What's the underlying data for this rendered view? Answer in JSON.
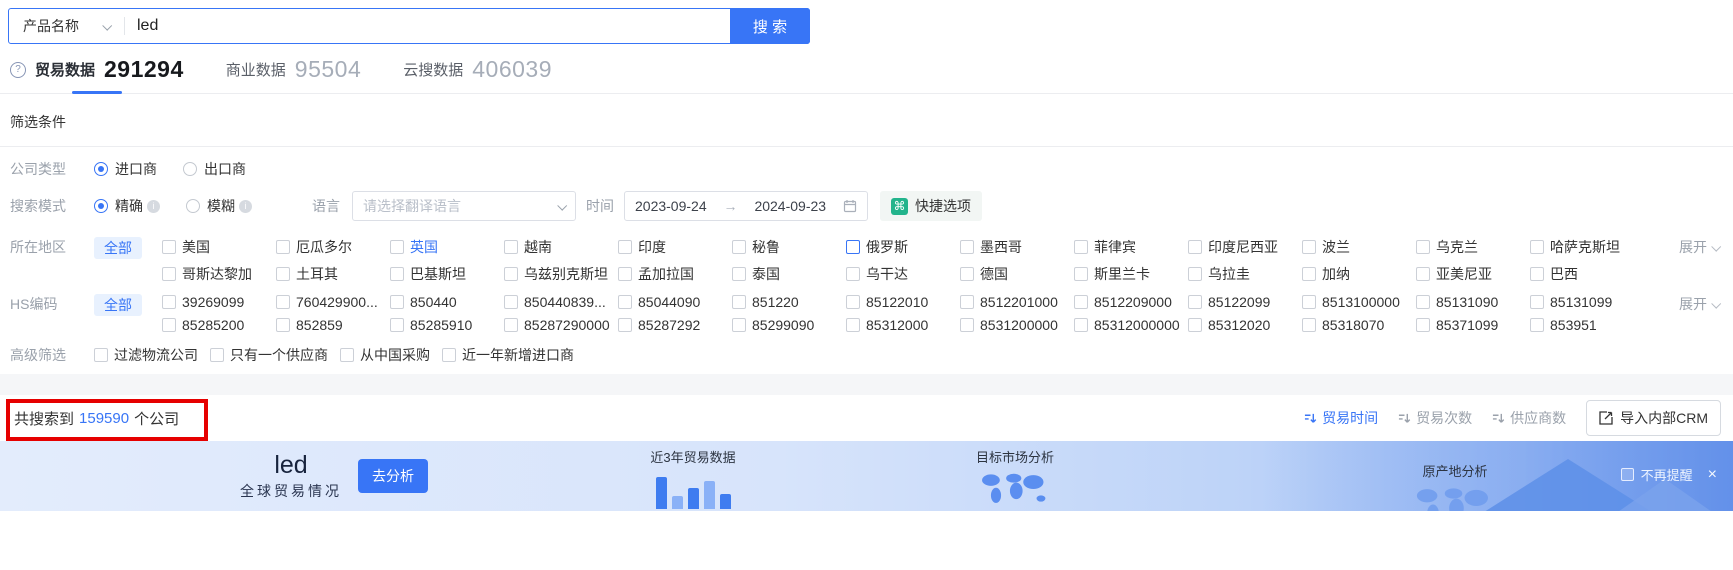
{
  "colors": {
    "accent": "#3875F6",
    "annotation_red": "#E60000",
    "quick_green": "#23B48C"
  },
  "search": {
    "category": "产品名称",
    "query": "led",
    "button": "搜 索"
  },
  "tabs": [
    {
      "label": "贸易数据",
      "count": "291294"
    },
    {
      "label": "商业数据",
      "count": "95504"
    },
    {
      "label": "云搜数据",
      "count": "406039"
    }
  ],
  "filter": {
    "title": "筛选条件",
    "company_type": {
      "label": "公司类型",
      "options": [
        "进口商",
        "出口商"
      ],
      "selected": "进口商"
    },
    "search_mode": {
      "label": "搜索模式",
      "options": [
        "精确",
        "模糊"
      ],
      "selected": "精确"
    },
    "language": {
      "label": "语言",
      "placeholder": "请选择翻译语言"
    },
    "time": {
      "label": "时间",
      "start": "2023-09-24",
      "separator": "→",
      "end": "2024-09-23"
    },
    "quick_option": "快捷选项",
    "region": {
      "label": "所在地区",
      "all": "全部",
      "expand": "展开",
      "row1": [
        "美国",
        "厄瓜多尔",
        "英国",
        "越南",
        "印度",
        "秘鲁",
        "俄罗斯",
        "墨西哥",
        "菲律宾",
        "印度尼西亚",
        "波兰",
        "乌克兰",
        "哈萨克斯坦"
      ],
      "row2": [
        "哥斯达黎加",
        "土耳其",
        "巴基斯坦",
        "乌兹别克斯坦",
        "孟加拉国",
        "泰国",
        "乌干达",
        "德国",
        "斯里兰卡",
        "乌拉圭",
        "加纳",
        "亚美尼亚",
        "巴西"
      ]
    },
    "hs_code": {
      "label": "HS编码",
      "all": "全部",
      "expand": "展开",
      "row1": [
        "39269099",
        "760429900...",
        "850440",
        "850440839...",
        "85044090",
        "851220",
        "85122010",
        "8512201000",
        "8512209000",
        "85122099",
        "8513100000",
        "85131090",
        "85131099"
      ],
      "row2": [
        "85285200",
        "852859",
        "85285910",
        "85287290000",
        "85287292",
        "85299090",
        "85312000",
        "8531200000",
        "85312000000",
        "85312020",
        "85318070",
        "85371099",
        "853951"
      ]
    },
    "advanced": {
      "label": "高级筛选",
      "options": [
        "过滤物流公司",
        "只有一个供应商",
        "从中国采购",
        "近一年新增进口商"
      ]
    }
  },
  "results": {
    "prefix": "共搜索到",
    "count": "159590",
    "suffix": "个公司",
    "sorts": [
      "贸易时间",
      "贸易次数",
      "供应商数"
    ],
    "active_sort": "贸易时间",
    "crm_button": "导入内部CRM"
  },
  "banner": {
    "keyword": "led",
    "subtitle": "全球贸易情况",
    "analyze_button": "去分析",
    "sections": [
      "近3年贸易数据",
      "目标市场分析",
      "原产地分析"
    ],
    "dismiss": "不再提醒"
  },
  "icons": {
    "question": "?",
    "command": "⌘",
    "close": "×"
  }
}
